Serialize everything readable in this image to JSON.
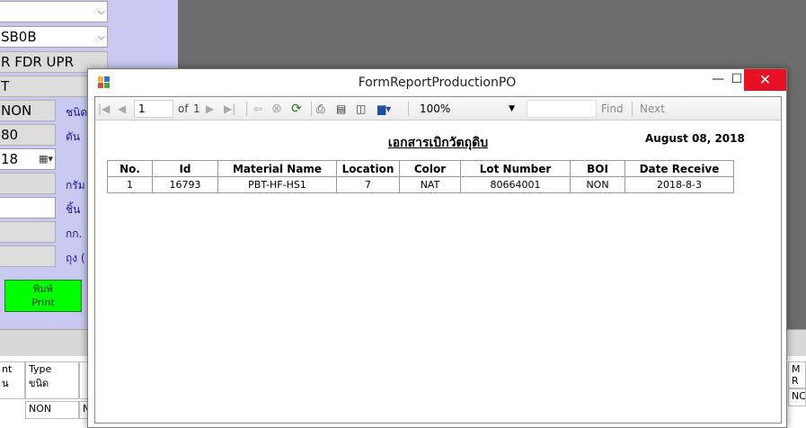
{
  "background": {
    "fields": [
      "",
      "SB0B",
      "R FDR UPR",
      "T",
      "NON",
      "80",
      "18",
      "",
      "",
      "",
      ""
    ],
    "labels": [
      "ชนิด",
      "ตัน",
      "กรัม",
      "ชิ้น",
      "กก.",
      "ถุง ("
    ],
    "print_button": {
      "line1": "พิมพ์",
      "line2": "Print"
    },
    "grid_headers": [
      "nt\nน",
      "Type\nขนิด",
      "M\nR"
    ],
    "grid_cells": [
      "NON",
      "N",
      "NC"
    ]
  },
  "dialog": {
    "title": "FormReportProductionPO",
    "buttons": {
      "minimize": "—",
      "maximize": "☐",
      "close": "✕"
    }
  },
  "toolbar": {
    "page_value": "1",
    "of_label": "of",
    "total_pages": "1",
    "zoom_value": "100%",
    "find_label": "Find",
    "next_label": "Next",
    "icons": [
      "first-page-icon",
      "prev-page-icon",
      "next-page-icon",
      "last-page-icon",
      "back-icon",
      "stop-icon",
      "refresh-icon",
      "print-icon",
      "print-layout-icon",
      "page-setup-icon",
      "export-icon"
    ]
  },
  "report": {
    "title": "เอกสารเบิกวัตถุดิบ",
    "date": "August 08, 2018",
    "columns": [
      "No.",
      "Id",
      "Material Name",
      "Location",
      "Color",
      "Lot Number",
      "BOI",
      "Date Receive"
    ],
    "rows": [
      [
        "1",
        "16793",
        "PBT-HF-HS1",
        "7",
        "NAT",
        "80664001",
        "NON",
        "2018-8-3"
      ]
    ]
  },
  "colors": {
    "side_panel": "#c8c8f0",
    "print_button": "#00ff00",
    "close_button": "#e81123"
  }
}
